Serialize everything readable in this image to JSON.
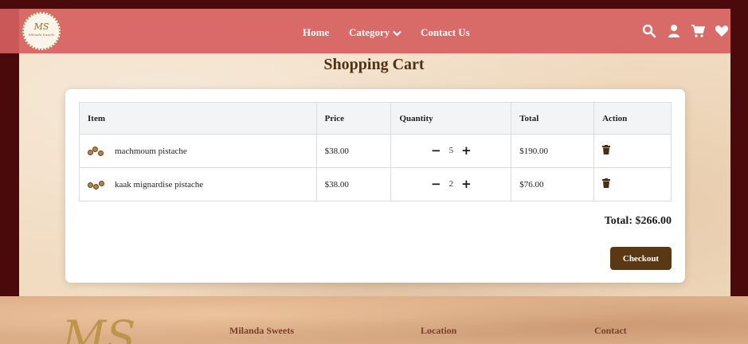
{
  "nav": {
    "logo_text": "MS",
    "logo_sub": "Milanda Sweets",
    "links": [
      {
        "label": "Home"
      },
      {
        "label": "Category"
      },
      {
        "label": "Contact Us"
      }
    ],
    "icons": [
      "search-icon",
      "user-icon",
      "cart-icon",
      "heart-icon"
    ]
  },
  "page_title": "Shopping Cart",
  "table": {
    "headers": [
      "Item",
      "Price",
      "Quantity",
      "Total",
      "Action"
    ],
    "rows": [
      {
        "item": "machmoum pistache",
        "price": "$38.00",
        "quantity": "5",
        "total": "$190.00"
      },
      {
        "item": "kaak mignardise pistache",
        "price": "$38.00",
        "quantity": "2",
        "total": "$76.00"
      }
    ]
  },
  "summary": {
    "total_label": "Total: $266.00",
    "checkout_label": "Checkout"
  },
  "footer": {
    "logo_text": "MS",
    "headings": [
      "Milanda Sweets",
      "Location",
      "Contact"
    ]
  },
  "colors": {
    "navbar": "#d66060",
    "brand_brown": "#5a3814",
    "title_brown": "#4e3211",
    "outer_maroon": "#4a0a0c"
  }
}
